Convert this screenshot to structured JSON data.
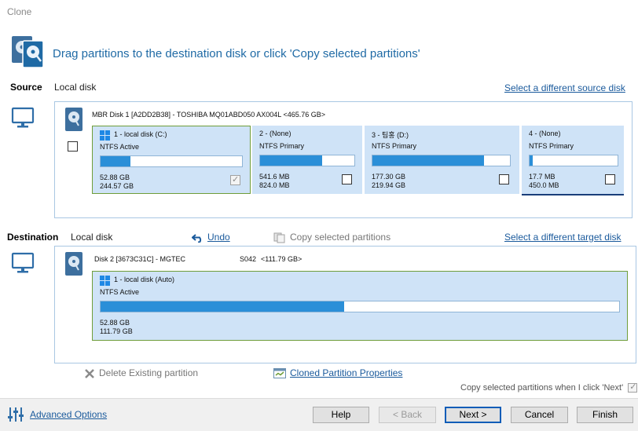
{
  "window": {
    "title": "Clone"
  },
  "header": {
    "instruction": "Drag partitions to the destination disk or click 'Copy selected partitions'"
  },
  "source": {
    "label": "Source",
    "type": "Local disk",
    "select_link": "Select a different source disk",
    "disk_title": "MBR Disk 1 [A2DD2B38] - TOSHIBA MQ01ABD050 AX004L  <465.76 GB>",
    "partitions": [
      {
        "name": "1 - local disk (C:)",
        "type": "NTFS Active",
        "used": "52.88 GB",
        "total": "244.57 GB",
        "fill": 0.21,
        "checked": true,
        "disabled": true,
        "windows": true
      },
      {
        "name": "2 -  (None)",
        "type": "NTFS Primary",
        "used": "541.6 MB",
        "total": "824.0 MB",
        "fill": 0.66,
        "checked": false,
        "windows": false
      },
      {
        "name": "3 - 팀홍 (D:)",
        "type": "NTFS Primary",
        "used": "177.30 GB",
        "total": "219.94 GB",
        "fill": 0.81,
        "checked": false,
        "windows": false
      },
      {
        "name": "4 -  (None)",
        "type": "NTFS Primary",
        "used": "17.7 MB",
        "total": "450.0 MB",
        "fill": 0.04,
        "checked": false,
        "windows": false
      }
    ]
  },
  "destination": {
    "label": "Destination",
    "type": "Local disk",
    "undo": "Undo",
    "copy_selected": "Copy selected partitions",
    "select_link": "Select a different target disk",
    "disk_title": "Disk 2 [3673C31C] - MGTEC",
    "disk_model": "S042",
    "disk_size": "<111.79 GB>",
    "partition": {
      "name": "1 - local disk (Auto)",
      "type": "NTFS Active",
      "used": "52.88 GB",
      "total": "111.79 GB",
      "fill": 0.47
    }
  },
  "actions": {
    "delete_existing": "Delete Existing partition",
    "cloned_properties": "Cloned Partition Properties",
    "copy_when_next": "Copy selected partitions when I click 'Next'"
  },
  "footer": {
    "advanced_options": "Advanced Options",
    "help": "Help",
    "back": "< Back",
    "next": "Next >",
    "cancel": "Cancel",
    "finish": "Finish"
  },
  "colors": {
    "accent": "#1f6aa5",
    "partition_bg": "#cfe3f7",
    "bar_fill": "#2b8fd8",
    "selected_border": "#6f9d3a"
  }
}
